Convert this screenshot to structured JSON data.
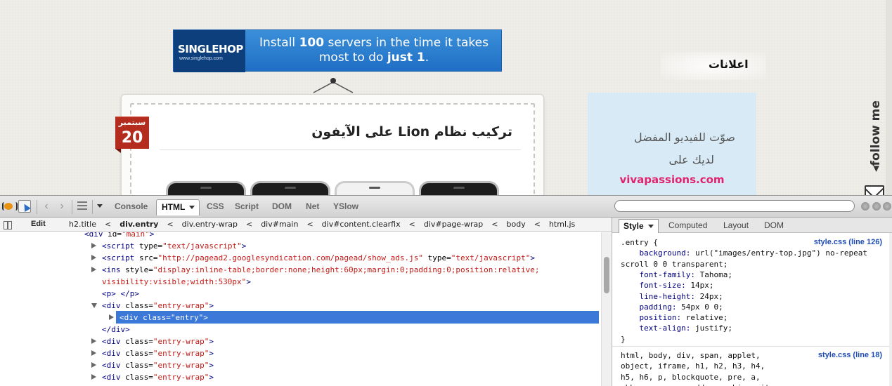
{
  "page": {
    "ad_banner": {
      "brand": "SINGLEHOP",
      "brand_url": "www.singlehop.com",
      "line1": "Install 100 servers in the time it takes",
      "line2": "most to do just 1."
    },
    "post": {
      "title": "تركيب نظام Lion على الآيفون",
      "date_month": "سبتمبر",
      "date_day": "20"
    },
    "sidebar": {
      "ads_heading": "اعلانات",
      "side_ad_line1": "صوّت للفيديو المفضل",
      "side_ad_line2": "لديك على",
      "side_ad_url": "vivapassions.com",
      "follow_me": "follow me"
    }
  },
  "firebug": {
    "tabs": [
      "Console",
      "HTML",
      "CSS",
      "Script",
      "DOM",
      "Net",
      "YSlow"
    ],
    "active_tab": "HTML",
    "search_placeholder": "",
    "edit_label": "Edit",
    "breadcrumbs": [
      "h2.title",
      "div.entry",
      "div.entry-wrap",
      "div#main",
      "div#content.clearfix",
      "div#page-wrap",
      "body",
      "html.js"
    ],
    "html_lines": [
      {
        "indent": 120,
        "twisty": "none",
        "parts": [
          [
            "tag",
            "<div "
          ],
          [
            "attr",
            "id="
          ],
          [
            "val",
            "\"main\""
          ],
          [
            "tag",
            ">"
          ]
        ]
      },
      {
        "indent": 145,
        "twisty": "closed",
        "parts": [
          [
            "tag",
            "<script "
          ],
          [
            "attr",
            "type="
          ],
          [
            "val",
            "\"text/javascript\""
          ],
          [
            "tag",
            ">"
          ]
        ]
      },
      {
        "indent": 145,
        "twisty": "closed",
        "parts": [
          [
            "tag",
            "<script "
          ],
          [
            "attr",
            "src="
          ],
          [
            "val",
            "\"http://pagead2.googlesyndication.com/pagead/show_ads.js\""
          ],
          [
            "attr",
            " type="
          ],
          [
            "val",
            "\"text/javascript\""
          ],
          [
            "tag",
            ">"
          ]
        ]
      },
      {
        "indent": 145,
        "twisty": "closed",
        "parts": [
          [
            "tag",
            "<ins "
          ],
          [
            "attr",
            "style="
          ],
          [
            "val",
            "\"display:inline-table;border:none;height:60px;margin:0;padding:0;position:relative;"
          ]
        ]
      },
      {
        "indent": 145,
        "twisty": "none",
        "parts": [
          [
            "val",
            "visibility:visible;width:530px\""
          ],
          [
            "tag",
            ">"
          ]
        ]
      },
      {
        "indent": 145,
        "twisty": "none",
        "parts": [
          [
            "tag",
            "<p>"
          ],
          [
            "txt",
            " "
          ],
          [
            "tag",
            "</p>"
          ]
        ]
      },
      {
        "indent": 145,
        "twisty": "open",
        "parts": [
          [
            "tag",
            "<div "
          ],
          [
            "attr",
            "class="
          ],
          [
            "val",
            "\"entry-wrap\""
          ],
          [
            "tag",
            ">"
          ]
        ]
      },
      {
        "indent": 170,
        "twisty": "closed",
        "selected": true,
        "parts": [
          [
            "tag",
            "<div "
          ],
          [
            "attr",
            "class="
          ],
          [
            "val",
            "\"entry\""
          ],
          [
            "tag",
            ">"
          ]
        ]
      },
      {
        "indent": 145,
        "twisty": "none",
        "parts": [
          [
            "tag",
            "</div>"
          ]
        ]
      },
      {
        "indent": 145,
        "twisty": "closed",
        "parts": [
          [
            "tag",
            "<div "
          ],
          [
            "attr",
            "class="
          ],
          [
            "val",
            "\"entry-wrap\""
          ],
          [
            "tag",
            ">"
          ]
        ]
      },
      {
        "indent": 145,
        "twisty": "closed",
        "parts": [
          [
            "tag",
            "<div "
          ],
          [
            "attr",
            "class="
          ],
          [
            "val",
            "\"entry-wrap\""
          ],
          [
            "tag",
            ">"
          ]
        ]
      },
      {
        "indent": 145,
        "twisty": "closed",
        "parts": [
          [
            "tag",
            "<div "
          ],
          [
            "attr",
            "class="
          ],
          [
            "val",
            "\"entry-wrap\""
          ],
          [
            "tag",
            ">"
          ]
        ]
      },
      {
        "indent": 145,
        "twisty": "closed",
        "parts": [
          [
            "tag",
            "<div "
          ],
          [
            "attr",
            "class="
          ],
          [
            "val",
            "\"entry-wrap\""
          ],
          [
            "tag",
            ">"
          ]
        ]
      },
      {
        "indent": 145,
        "twisty": "closed",
        "parts": [
          [
            "tag",
            "<div "
          ],
          [
            "attr",
            "class="
          ],
          [
            "val",
            "\"entry-wrap\""
          ],
          [
            "tag",
            ">"
          ]
        ]
      }
    ],
    "side_tabs": [
      "Style",
      "Computed",
      "Layout",
      "DOM"
    ],
    "active_side_tab": "Style",
    "css_rules": [
      {
        "source": "style.css (line 126)",
        "lines": [
          [
            [
              "sel",
              ".entry {"
            ]
          ],
          [
            [
              "ind",
              "    "
            ],
            [
              "prop",
              "background: "
            ],
            [
              "v",
              "url(\"images/entry-top.jpg\") no-repeat"
            ]
          ],
          [
            [
              "v",
              "scroll 0 0 transparent;"
            ]
          ],
          [
            [
              "ind",
              "    "
            ],
            [
              "prop",
              "font-family: "
            ],
            [
              "v",
              "Tahoma;"
            ]
          ],
          [
            [
              "ind",
              "    "
            ],
            [
              "prop",
              "font-size: "
            ],
            [
              "v",
              "14px;"
            ]
          ],
          [
            [
              "ind",
              "    "
            ],
            [
              "prop",
              "line-height: "
            ],
            [
              "v",
              "24px;"
            ]
          ],
          [
            [
              "ind",
              "    "
            ],
            [
              "prop",
              "padding: "
            ],
            [
              "v",
              "54px 0 0;"
            ]
          ],
          [
            [
              "ind",
              "    "
            ],
            [
              "prop",
              "position: "
            ],
            [
              "v",
              "relative;"
            ]
          ],
          [
            [
              "ind",
              "    "
            ],
            [
              "prop",
              "text-align: "
            ],
            [
              "v",
              "justify;"
            ]
          ],
          [
            [
              "sel",
              "}"
            ]
          ]
        ]
      },
      {
        "source": "style.css (line 18)",
        "lines": [
          [
            [
              "sel",
              "html, body, div, span, applet,"
            ]
          ],
          [
            [
              "sel",
              "object, iframe, h1, h2, h3, h4,"
            ]
          ],
          [
            [
              "sel",
              "h5, h6, p, blockquote, pre, a,"
            ]
          ],
          [
            [
              "sel",
              "abbr, acronym, address, big, cite,"
            ]
          ]
        ]
      }
    ]
  }
}
